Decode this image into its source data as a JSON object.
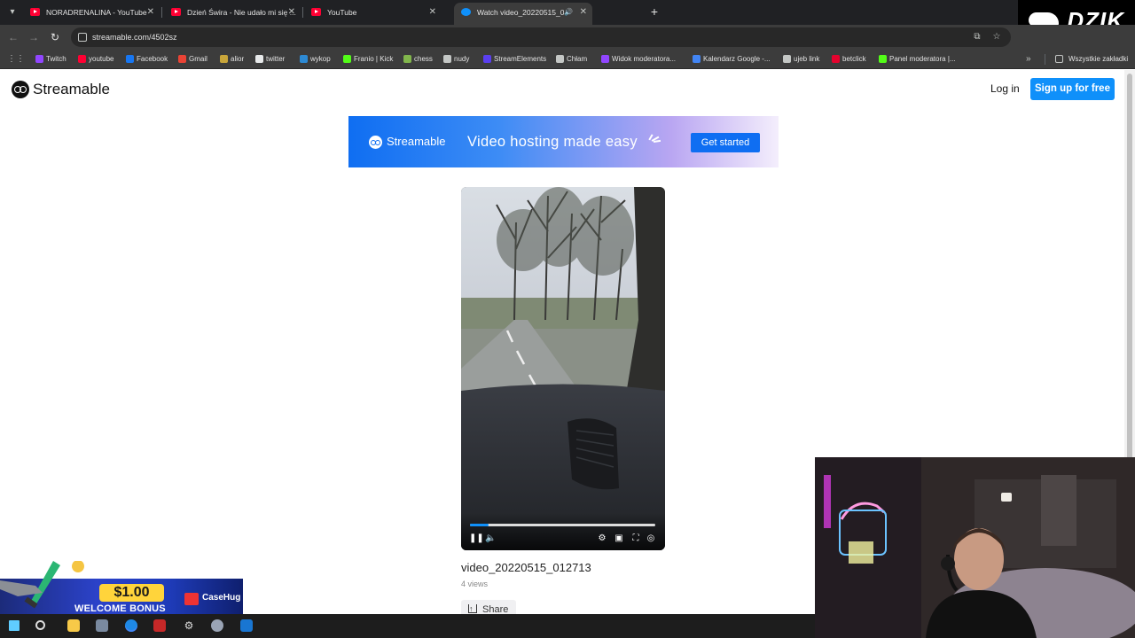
{
  "browser": {
    "tabs": [
      {
        "title": "NORADRENALINA - YouTube",
        "active": false
      },
      {
        "title": "Dzień Świra - Nie udało mi się ...",
        "active": false
      },
      {
        "title": "YouTube",
        "active": false
      },
      {
        "title": "Watch video_20220515_01...",
        "active": true
      }
    ],
    "new_tab": "+",
    "url": "streamable.com/4502sz",
    "bookmarks": [
      {
        "label": "Twitch",
        "color": "#9146ff"
      },
      {
        "label": "youtube",
        "color": "#ff0033"
      },
      {
        "label": "Facebook",
        "color": "#1877f2"
      },
      {
        "label": "Gmail",
        "color": "#ea4335"
      },
      {
        "label": "alior",
        "color": "#c8a53a"
      },
      {
        "label": "twitter",
        "color": "#e7e9ea"
      },
      {
        "label": "wykop",
        "color": "#2d8ad4"
      },
      {
        "label": "Franio | Kick",
        "color": "#53fc18"
      },
      {
        "label": "chess",
        "color": "#81b64c"
      },
      {
        "label": "nudy",
        "color": "#c4c7c5"
      },
      {
        "label": "StreamElements",
        "color": "#5a3ff0"
      },
      {
        "label": "Chłam",
        "color": "#c4c7c5"
      },
      {
        "label": "Widok moderatora...",
        "color": "#9146ff"
      },
      {
        "label": "Kalendarz Google -...",
        "color": "#4285f4"
      },
      {
        "label": "ujeb link",
        "color": "#c4c7c5"
      },
      {
        "label": "betclick",
        "color": "#e4032e"
      },
      {
        "label": "Panel moderatora |...",
        "color": "#53fc18"
      }
    ],
    "all_bookmarks": "Wszystkie zakładki"
  },
  "overlay": {
    "dzik_brand": "DZIK",
    "bonus_amount": "$1.00",
    "bonus_label": "WELCOME BONUS",
    "bonus_brand": "CaseHug"
  },
  "site": {
    "brand": "Streamable",
    "login": "Log in",
    "signup": "Sign up for free",
    "banner": {
      "brand": "Streamable",
      "tagline": "Video hosting made easy",
      "cta": "Get started"
    },
    "video": {
      "title": "video_20220515_012713",
      "views": "4 views",
      "share": "Share",
      "progress": 0.1
    }
  },
  "colors": {
    "accent": "#0f90fa",
    "chrome_dark": "#202124",
    "chrome_mid": "#3c3c3c"
  }
}
